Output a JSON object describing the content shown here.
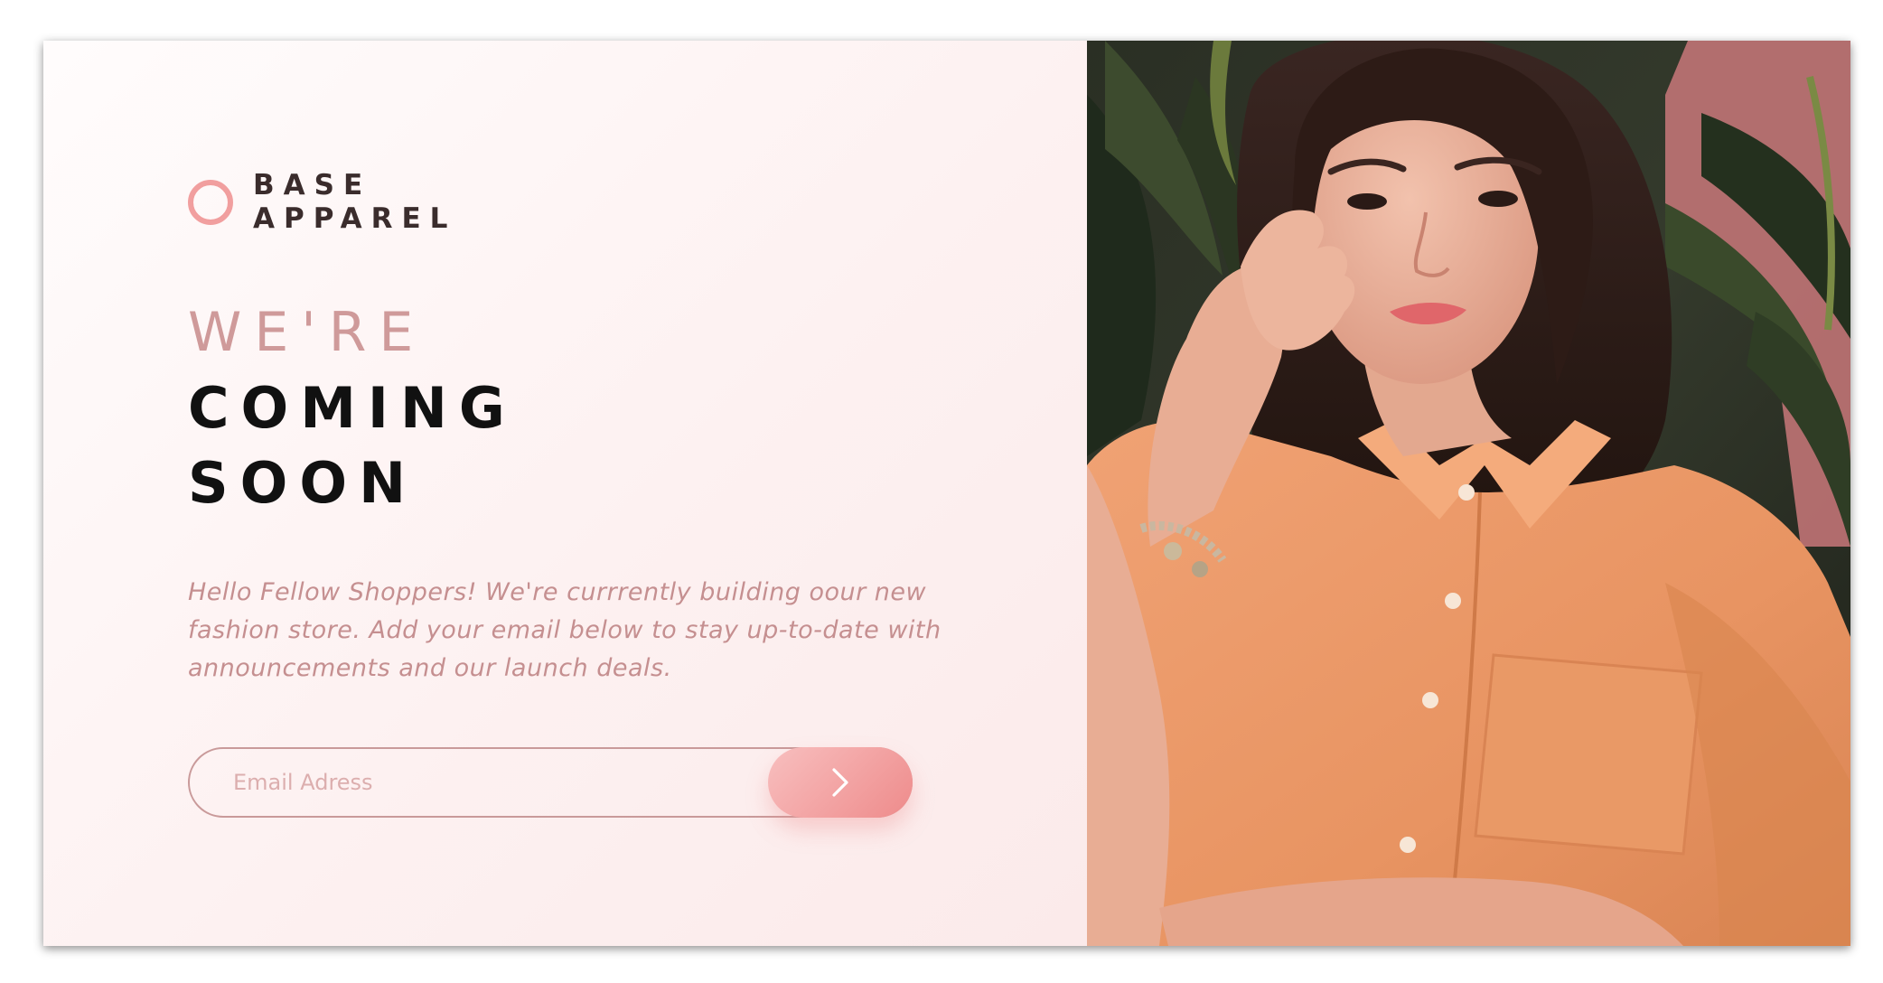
{
  "brand": {
    "line1": "BASE",
    "line2": "APPAREL"
  },
  "heading": {
    "line1": "WE'RE",
    "line2": "COMING",
    "line3": "SOON"
  },
  "description": "Hello Fellow Shoppers! We're currrently building oour new fashion store. Add your email below to stay up-to-date with announcements and our launch deals.",
  "form": {
    "email_placeholder": "Email Adress",
    "email_value": "",
    "submit_icon": "chevron-right-icon"
  },
  "hero_image": {
    "alt": "Woman in orange shirt"
  },
  "colors": {
    "accent": "#ee8b8b",
    "accent_light": "#f8bfbf",
    "text_muted": "#c58f90",
    "heading_dark": "#111111",
    "background": "#fdf1f1"
  }
}
